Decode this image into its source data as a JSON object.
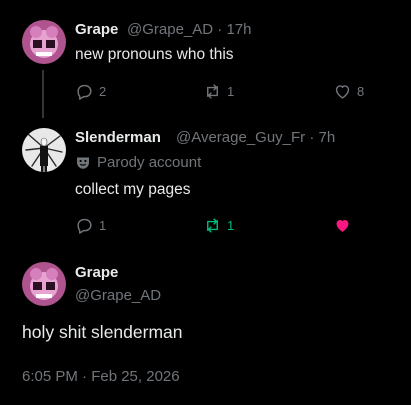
{
  "tweet1": {
    "display_name": "Grape",
    "handle": "@Grape_AD",
    "sep": "·",
    "time": "17h",
    "text": "new pronouns who this",
    "replies": "2",
    "retweets": "1",
    "likes": "8"
  },
  "tweet2": {
    "display_name": "Slenderman",
    "handle": "@Average_Guy_Fr",
    "sep": "·",
    "time": "7h",
    "badge": "Parody account",
    "text": "collect my pages",
    "replies": "1",
    "retweets": "1",
    "retweeted": true,
    "liked": true
  },
  "focus_tweet": {
    "display_name": "Grape",
    "handle": "@Grape_AD",
    "text": "holy shit slenderman",
    "timestamp": "6:05 PM · Feb 25, 2026"
  },
  "colors": {
    "background": "#000000",
    "text": "#e7e9ea",
    "muted": "#71767b",
    "retweet_active": "#00ba7c",
    "like_active": "#f91880",
    "thread_line": "#333639"
  },
  "icons": {
    "reply": "reply-icon",
    "retweet": "retweet-icon",
    "like": "heart-icon",
    "parody": "theater-mask-icon"
  }
}
